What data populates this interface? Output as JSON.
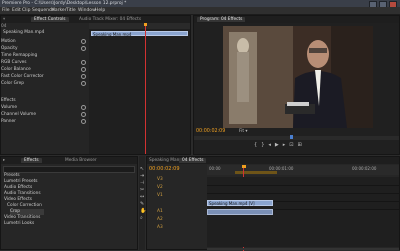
{
  "title_bar": {
    "title": "Premiere Pro - C:\\Users\\Jordy\\Desktop\\Lesson 12.prproj *"
  },
  "menu": [
    "File",
    "Edit",
    "Clip",
    "Sequence",
    "Marker",
    "Title",
    "Window",
    "Help"
  ],
  "effect_controls": {
    "tabs": [
      "Effect Controls",
      "Audio Track Mixer: 04 Effects"
    ],
    "sequence_clip": "04",
    "clip_label": "Speaking Man.mp4",
    "rows": [
      "Speaking Man.mp4",
      "Motion",
      "Opacity",
      "Time Remapping",
      "RGB Curves",
      "Color Balance",
      "Fast Color Corrector",
      "Color Grep",
      "Effects",
      "Volume",
      "Channel Volume",
      "Panner"
    ],
    "sub_row": "Speaking Man.mp4"
  },
  "program_monitor": {
    "tab": "Program: 04 Effects",
    "timecode": "00:00:02:09",
    "fit": "Fit"
  },
  "effects_panel": {
    "tabs": [
      "Effects",
      "Media Browser"
    ],
    "items": [
      "Presets",
      "Lumetri Presets",
      "Audio Effects",
      "Audio Transitions",
      "Video Effects",
      "Color Correction",
      "Crop",
      "Video Transitions",
      "Lumetri Looks"
    ]
  },
  "timeline": {
    "tabs": [
      "Speaking Man",
      "04 Effects"
    ],
    "timecode": "00:00:02:09",
    "ruler": [
      "00:00",
      "00:00:01:00",
      "00:00:02:00"
    ],
    "tracks": [
      "V3",
      "V2",
      "V1",
      "A1",
      "A2",
      "A3"
    ],
    "clip_v1": "Speaking Man.mp4 [V]"
  },
  "colors": {
    "accent": "#f0a020",
    "clip_blue": "#8aa4cf",
    "playhead": "#d23232",
    "timecode": "#f0a020"
  }
}
